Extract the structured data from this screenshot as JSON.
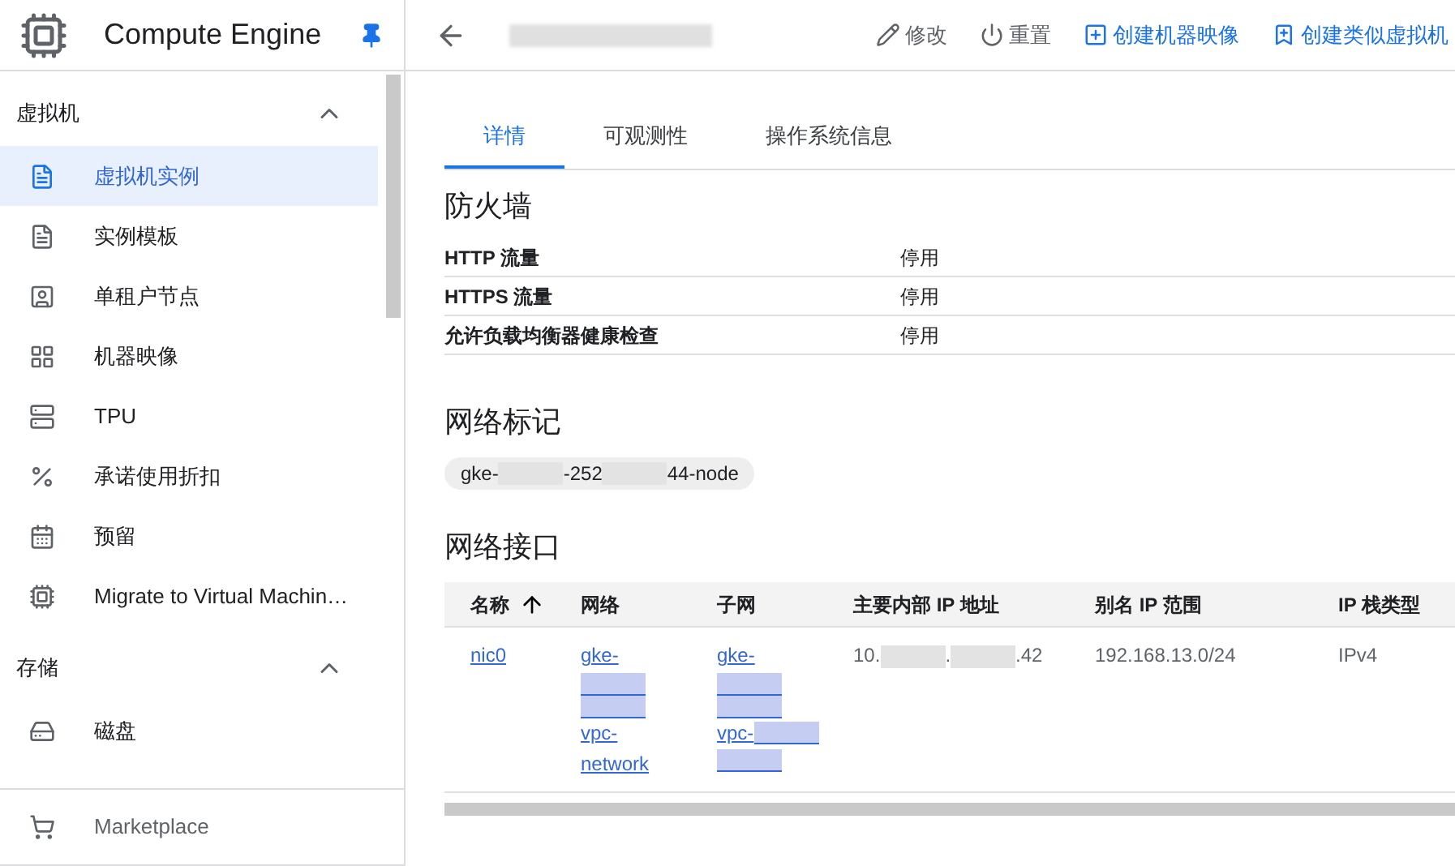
{
  "sidebar": {
    "title": "Compute Engine",
    "pinned": true,
    "sections": [
      {
        "label": "虚拟机",
        "expanded": true,
        "items": [
          {
            "label": "虚拟机实例",
            "selected": true
          },
          {
            "label": "实例模板",
            "selected": false
          },
          {
            "label": "单租户节点",
            "selected": false
          },
          {
            "label": "机器映像",
            "selected": false
          },
          {
            "label": "TPU",
            "selected": false
          },
          {
            "label": "承诺使用折扣",
            "selected": false
          },
          {
            "label": "预留",
            "selected": false
          },
          {
            "label": "Migrate to Virtual Machin…",
            "selected": false
          }
        ]
      },
      {
        "label": "存储",
        "expanded": true,
        "items": [
          {
            "label": "磁盘",
            "selected": false
          }
        ]
      }
    ],
    "footer": {
      "label": "Marketplace"
    }
  },
  "header": {
    "actions": [
      {
        "label": "修改",
        "kind": "plain"
      },
      {
        "label": "重置",
        "kind": "plain"
      },
      {
        "label": "创建机器映像",
        "kind": "primary"
      },
      {
        "label": "创建类似虚拟机",
        "kind": "primary"
      }
    ]
  },
  "tabs": [
    {
      "label": "详情",
      "selected": true
    },
    {
      "label": "可观测性",
      "selected": false
    },
    {
      "label": "操作系统信息",
      "selected": false
    }
  ],
  "firewall": {
    "title": "防火墙",
    "rows": [
      {
        "label": "HTTP 流量",
        "value": "停用"
      },
      {
        "label": "HTTPS 流量",
        "value": "停用"
      },
      {
        "label": "允许负载均衡器健康检查",
        "value": "停用"
      }
    ]
  },
  "network_tags": {
    "title": "网络标记",
    "tag": [
      {
        "kind": "text",
        "text": "gke-"
      },
      {
        "kind": "redacted"
      },
      {
        "kind": "text",
        "text": "-252"
      },
      {
        "kind": "redacted"
      },
      {
        "kind": "text",
        "text": "44-node"
      }
    ]
  },
  "network_interfaces": {
    "title": "网络接口",
    "columns": [
      {
        "label": "名称",
        "sorted": true
      },
      {
        "label": "网络",
        "sorted": false
      },
      {
        "label": "子网",
        "sorted": false
      },
      {
        "label": "主要内部 IP 地址",
        "sorted": false
      },
      {
        "label": "别名 IP 范围",
        "sorted": false
      },
      {
        "label": "IP 栈类型",
        "sorted": false
      }
    ],
    "rows": [
      {
        "cells": [
          {
            "kind": "link",
            "lines": [
              [
                {
                  "kind": "text",
                  "text": "nic0"
                }
              ]
            ]
          },
          {
            "kind": "link",
            "lines": [
              [
                {
                  "kind": "text",
                  "text": "gke-"
                }
              ],
              [
                {
                  "kind": "redacted"
                }
              ],
              [
                {
                  "kind": "redacted"
                }
              ],
              [
                {
                  "kind": "text",
                  "text": "vpc-"
                }
              ],
              [
                {
                  "kind": "text",
                  "text": "network"
                }
              ]
            ]
          },
          {
            "kind": "link",
            "lines": [
              [
                {
                  "kind": "text",
                  "text": "gke-"
                }
              ],
              [
                {
                  "kind": "redacted"
                }
              ],
              [
                {
                  "kind": "redacted"
                }
              ],
              [
                {
                  "kind": "text",
                  "text": "vpc-"
                },
                {
                  "kind": "redacted"
                }
              ],
              [
                {
                  "kind": "redacted"
                }
              ]
            ]
          },
          {
            "kind": "plain",
            "lines": [
              [
                {
                  "kind": "text",
                  "text": "10."
                },
                {
                  "kind": "redacted"
                },
                {
                  "kind": "text",
                  "text": "."
                },
                {
                  "kind": "redacted"
                },
                {
                  "kind": "text",
                  "text": ".42"
                }
              ]
            ]
          },
          {
            "kind": "plain",
            "lines": [
              [
                {
                  "kind": "text",
                  "text": "192.168.13.0/24"
                }
              ]
            ]
          },
          {
            "kind": "plain",
            "lines": [
              [
                {
                  "kind": "text",
                  "text": "IPv4"
                }
              ]
            ]
          }
        ]
      }
    ]
  }
}
